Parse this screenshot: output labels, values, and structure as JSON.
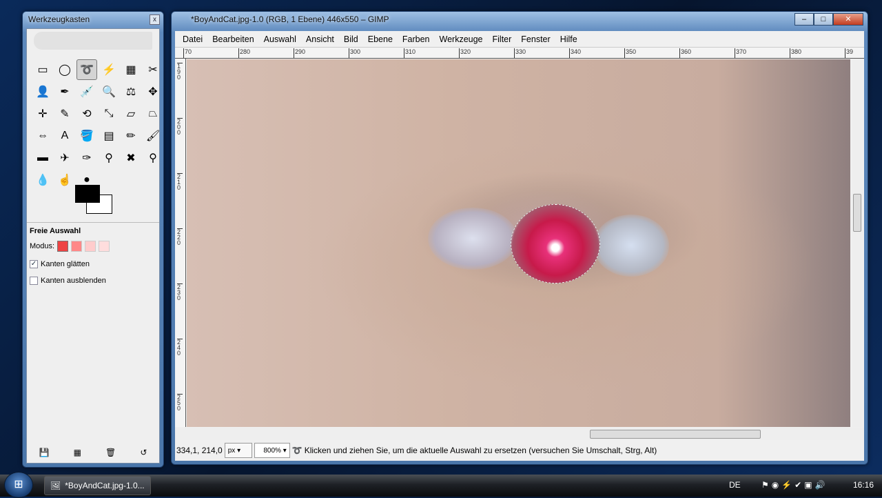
{
  "toolbox": {
    "title": "Werkzeugkasten",
    "close": "x",
    "tools": [
      {
        "name": "rect-select",
        "g": "▭"
      },
      {
        "name": "ellipse-select",
        "g": "◯"
      },
      {
        "name": "free-select",
        "g": "➰"
      },
      {
        "name": "fuzzy-select",
        "g": "⚡"
      },
      {
        "name": "select-by-color",
        "g": "▦"
      },
      {
        "name": "scissors",
        "g": "✂"
      },
      {
        "name": "foreground-select",
        "g": "👤"
      },
      {
        "name": "paths",
        "g": "✒"
      },
      {
        "name": "color-picker",
        "g": "💉"
      },
      {
        "name": "zoom",
        "g": "🔍"
      },
      {
        "name": "measure",
        "g": "⚖"
      },
      {
        "name": "move",
        "g": "✥"
      },
      {
        "name": "align",
        "g": "✛"
      },
      {
        "name": "crop",
        "g": "✎"
      },
      {
        "name": "rotate",
        "g": "⟲"
      },
      {
        "name": "scale",
        "g": "⤡"
      },
      {
        "name": "shear",
        "g": "▱"
      },
      {
        "name": "perspective",
        "g": "⏢"
      },
      {
        "name": "flip",
        "g": "⇔"
      },
      {
        "name": "text",
        "g": "A"
      },
      {
        "name": "bucket-fill",
        "g": "🪣"
      },
      {
        "name": "blend",
        "g": "▤"
      },
      {
        "name": "pencil",
        "g": "✏"
      },
      {
        "name": "paintbrush",
        "g": "🖌"
      },
      {
        "name": "eraser",
        "g": "▬"
      },
      {
        "name": "airbrush",
        "g": "✈"
      },
      {
        "name": "ink",
        "g": "✑"
      },
      {
        "name": "clone",
        "g": "⚲"
      },
      {
        "name": "heal",
        "g": "✖"
      },
      {
        "name": "perspective-clone",
        "g": "⚲"
      },
      {
        "name": "blur-sharpen",
        "g": "💧"
      },
      {
        "name": "smudge",
        "g": "☝"
      },
      {
        "name": "dodge-burn",
        "g": "●"
      }
    ],
    "options": {
      "title": "Freie Auswahl",
      "mode_label": "Modus:",
      "antialias": "Kanten glätten",
      "feather": "Kanten ausblenden"
    }
  },
  "window": {
    "title": "*BoyAndCat.jpg-1.0 (RGB, 1 Ebene) 446x550 – GIMP",
    "menu": [
      "Datei",
      "Bearbeiten",
      "Auswahl",
      "Ansicht",
      "Bild",
      "Ebene",
      "Farben",
      "Werkzeuge",
      "Filter",
      "Fenster",
      "Hilfe"
    ],
    "hruler": [
      "70",
      "280",
      "290",
      "300",
      "310",
      "320",
      "330",
      "340",
      "350",
      "360",
      "370",
      "380",
      "39"
    ],
    "vruler": [
      "190",
      "200",
      "210",
      "220",
      "230",
      "240",
      "250"
    ],
    "status": {
      "coords": "334,1, 214,0",
      "unit": "px",
      "zoom": "800%",
      "message": "Klicken und ziehen Sie, um die aktuelle Auswahl zu ersetzen (versuchen Sie Umschalt, Strg, Alt)"
    }
  },
  "taskbar": {
    "task": "*BoyAndCat.jpg-1.0...",
    "lang": "DE",
    "time": "16:16"
  }
}
